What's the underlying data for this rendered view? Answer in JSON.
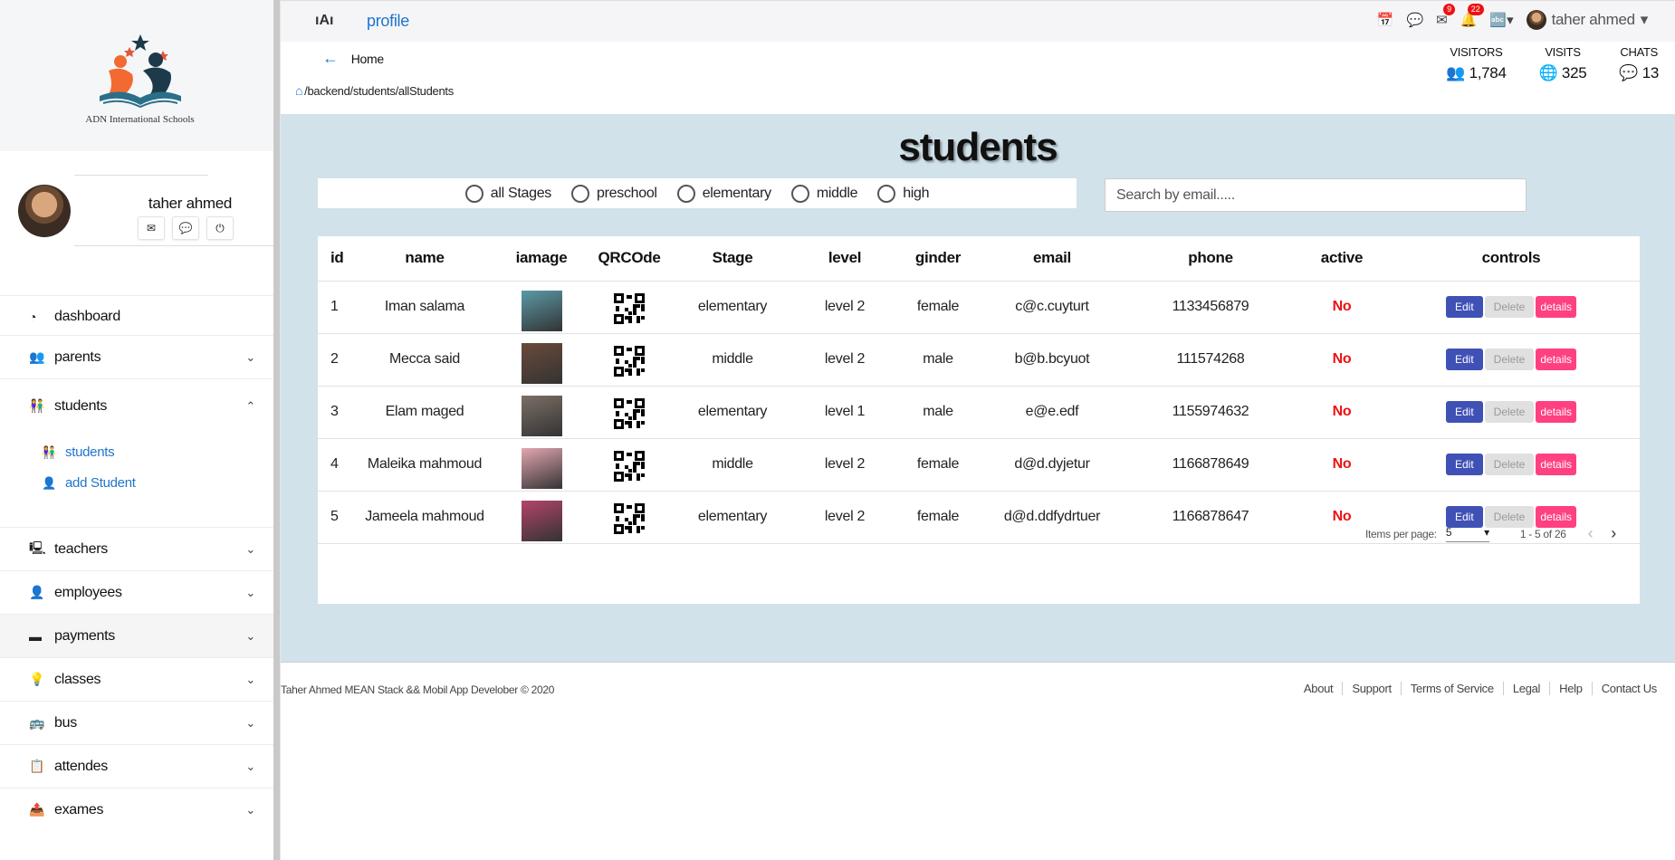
{
  "brand": {
    "logo_caption": "ADN International Schools"
  },
  "sidebar": {
    "user_name": "taher ahmed",
    "items": [
      {
        "label": "dashboard",
        "icon": "dashboard-icon"
      },
      {
        "label": "parents",
        "icon": "users-icon"
      },
      {
        "label": "students",
        "icon": "students-icon"
      },
      {
        "label": "teachers",
        "icon": "teacher-icon"
      },
      {
        "label": "employees",
        "icon": "person-icon"
      },
      {
        "label": "payments",
        "icon": "wallet-icon"
      },
      {
        "label": "classes",
        "icon": "lightbulb-icon"
      },
      {
        "label": "bus",
        "icon": "bus-icon"
      },
      {
        "label": "attendes",
        "icon": "clipboard-icon"
      },
      {
        "label": "exames",
        "icon": "exam-icon"
      }
    ],
    "students_sub": [
      {
        "label": "students"
      },
      {
        "label": "add Student"
      }
    ]
  },
  "topbar": {
    "logo_text": "ıAı",
    "profile_link": "profile",
    "messages_badge": "9",
    "notifications_badge": "22",
    "user_name": "taher ahmed"
  },
  "subheader": {
    "back_label": "Home",
    "breadcrumb": "/backend/students/allStudents",
    "stats": [
      {
        "label": "VISITORS",
        "value": "1,784"
      },
      {
        "label": "VISITS",
        "value": "325"
      },
      {
        "label": "CHATS",
        "value": "13"
      }
    ]
  },
  "main": {
    "title": "students",
    "filters": [
      "all Stages",
      "preschool",
      "elementary",
      "middle",
      "high"
    ],
    "search_placeholder": "Search by email.....",
    "columns": [
      "id",
      "name",
      "iamage",
      "QRCOde",
      "Stage",
      "level",
      "ginder",
      "email",
      "phone",
      "active",
      "controls"
    ],
    "rows": [
      {
        "id": "1",
        "name": "Iman salama",
        "stage": "elementary",
        "level": "level 2",
        "gender": "female",
        "email": "c@c.cuyturt",
        "phone": "1133456879",
        "active": "No",
        "img_color": "#5a9aa8"
      },
      {
        "id": "2",
        "name": "Mecca said",
        "stage": "middle",
        "level": "level 2",
        "gender": "male",
        "email": "b@b.bcyuot",
        "phone": "111574268",
        "active": "No",
        "img_color": "#6b4a3a"
      },
      {
        "id": "3",
        "name": "Elam maged",
        "stage": "elementary",
        "level": "level 1",
        "gender": "male",
        "email": "e@e.edf",
        "phone": "1155974632",
        "active": "No",
        "img_color": "#7c6f66"
      },
      {
        "id": "4",
        "name": "Maleika mahmoud",
        "stage": "middle",
        "level": "level 2",
        "gender": "female",
        "email": "d@d.dyjetur",
        "phone": "1166878649",
        "active": "No",
        "img_color": "#e3a6b0"
      },
      {
        "id": "5",
        "name": "Jameela mahmoud",
        "stage": "elementary",
        "level": "level 2",
        "gender": "female",
        "email": "d@d.ddfydrtuer",
        "phone": "1166878647",
        "active": "No",
        "img_color": "#b4446a"
      }
    ],
    "buttons": {
      "edit": "Edit",
      "delete": "Delete",
      "details": "details"
    },
    "paginator": {
      "label": "Items per page:",
      "page_size": "5",
      "range": "1 - 5 of 26"
    }
  },
  "footer": {
    "copyright": "Taher Ahmed MEAN Stack && Mobil App Develober © 2020",
    "links": [
      "About",
      "Support",
      "Terms of Service",
      "Legal",
      "Help",
      "Contact Us"
    ]
  },
  "colors": {
    "accent": "#1f75cb",
    "main_bg": "#d2e2ea",
    "edit": "#3f51b5",
    "details": "#ff4081",
    "danger": "#ee1111"
  }
}
